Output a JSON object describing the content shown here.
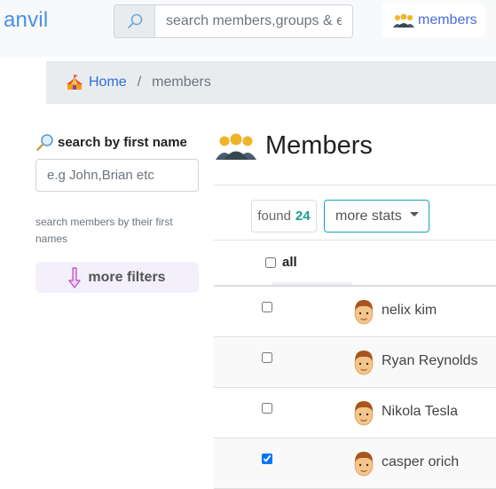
{
  "nav": {
    "brand": "anvil",
    "search_placeholder": "search members,groups & events",
    "members_label": "members"
  },
  "breadcrumb": {
    "home": "Home",
    "separator": "/",
    "current": "members"
  },
  "sidebar": {
    "title": "search by first name",
    "name_placeholder": "e.g John,Brian etc",
    "help": "search members by their first names",
    "filters_label": "more filters"
  },
  "main": {
    "title": "Members",
    "found_label": "found",
    "found_count": "24",
    "stats_label": "more stats",
    "select_all_label": "all",
    "members": [
      {
        "name": "nelix kim",
        "checked": false
      },
      {
        "name": "Ryan Reynolds",
        "checked": false
      },
      {
        "name": "Nikola Tesla",
        "checked": false
      },
      {
        "name": "casper orich",
        "checked": true
      }
    ]
  },
  "colors": {
    "brand": "#4a90e2",
    "link": "#4a6cd4",
    "count": "#1a9e96",
    "stats_border": "#17a2b8"
  },
  "icons": {
    "search": "magnifier-icon",
    "members": "people-group-icon",
    "home": "circus-tent-icon",
    "filters": "down-arrow-icon",
    "avatar": "face-icon"
  }
}
